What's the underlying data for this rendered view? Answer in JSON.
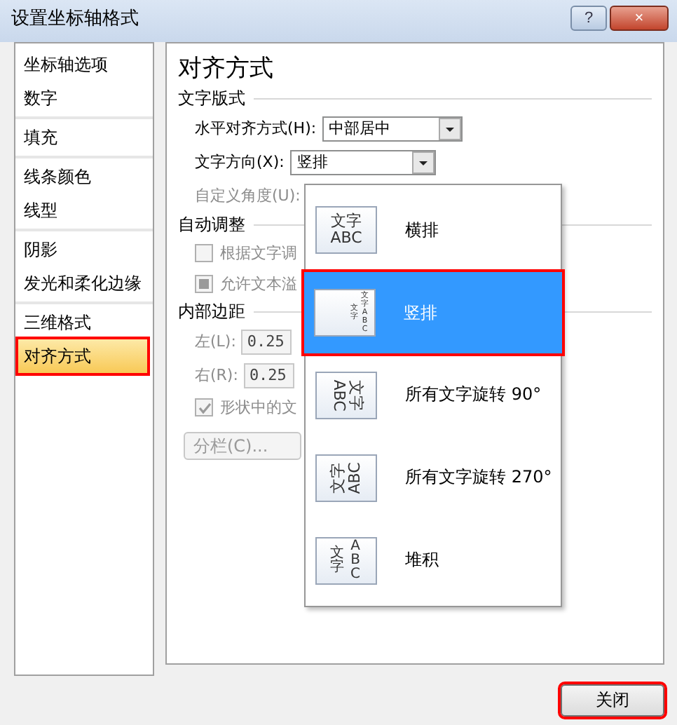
{
  "window": {
    "title": "设置坐标轴格式",
    "buttons": [
      "?",
      "×"
    ]
  },
  "sidebar": {
    "groups": [
      {
        "items": [
          {
            "label": "坐标轴选项",
            "selected": false
          },
          {
            "label": "数字",
            "selected": false
          }
        ]
      },
      {
        "items": [
          {
            "label": "填充",
            "selected": false
          }
        ]
      },
      {
        "items": [
          {
            "label": "线条颜色",
            "selected": false
          },
          {
            "label": "线型",
            "selected": false
          }
        ]
      },
      {
        "items": [
          {
            "label": "阴影",
            "selected": false
          },
          {
            "label": "发光和柔化边缘",
            "selected": false
          }
        ]
      },
      {
        "items": [
          {
            "label": "三维格式",
            "selected": false
          },
          {
            "label": "对齐方式",
            "selected": true
          }
        ]
      }
    ]
  },
  "panel": {
    "title": "对齐方式",
    "text_layout": {
      "heading": "文字版式",
      "h_align": {
        "label": "水平对齐方式(H):",
        "value": "中部居中"
      },
      "direction": {
        "label": "文字方向(X):",
        "value": "竖排"
      },
      "angle": {
        "label": "自定义角度(U):",
        "disabled": true
      }
    },
    "autofit": {
      "heading": "自动调整",
      "options": [
        {
          "label": "根据文字调",
          "checked": false,
          "indeterminate": false
        },
        {
          "label": "允许文本溢",
          "indeterminate": true
        }
      ]
    },
    "margins": {
      "heading": "内部边距",
      "fields": [
        {
          "label": "左(L):",
          "value": "0.25"
        },
        {
          "label": "右(R):",
          "value": "0.25"
        }
      ],
      "wrap": {
        "label": "形状中的文",
        "checked": true,
        "indeterminate": false
      },
      "columns_button": "分栏(C)..."
    }
  },
  "direction_menu": [
    {
      "kind": "horizontal",
      "label": "横排",
      "icon_lines": [
        "文字",
        "ABC"
      ],
      "selected": false
    },
    {
      "kind": "vertical",
      "label": "竖排",
      "icon_lines": [
        "文字",
        "文字ABC"
      ],
      "selected": true
    },
    {
      "kind": "rotate90",
      "label": "所有文字旋转 90°",
      "icon_lines": [
        "文字",
        "ABC"
      ],
      "selected": false
    },
    {
      "kind": "rotate270",
      "label": "所有文字旋转 270°",
      "icon_lines": [
        "文字",
        "ABC"
      ],
      "selected": false
    },
    {
      "kind": "stacked",
      "label": "堆积",
      "icon_lines": [
        "文字",
        "ABC"
      ],
      "selected": false
    }
  ],
  "footer": {
    "close_button": "关闭"
  }
}
